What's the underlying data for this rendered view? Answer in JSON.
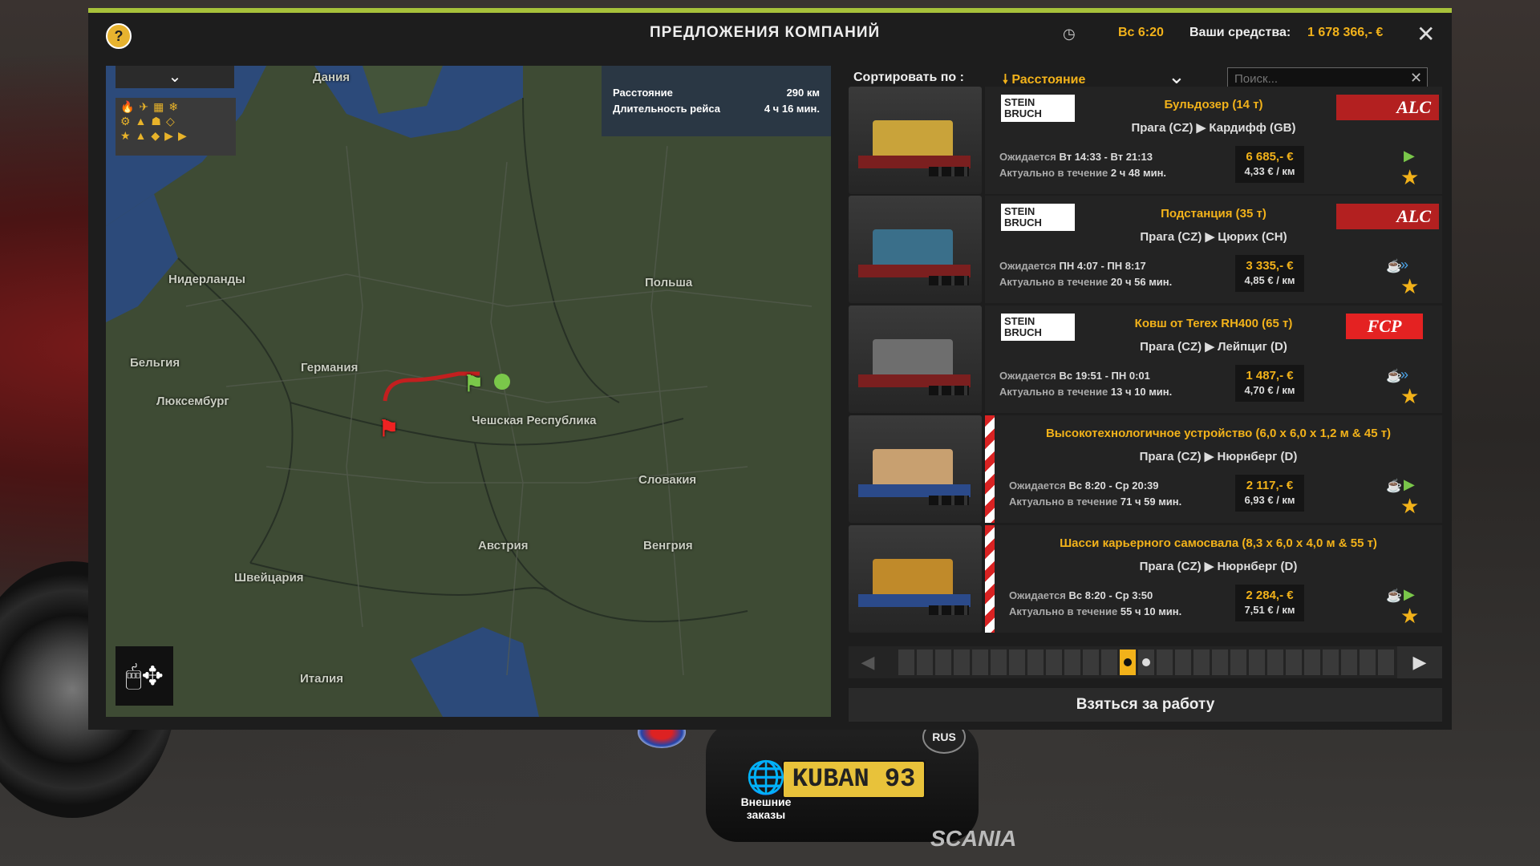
{
  "header": {
    "title": "ПРЕДЛОЖЕНИЯ КОМПАНИЙ",
    "help": "?",
    "clock_icon": "clock-icon",
    "time": "Вс 6:20",
    "funds_label": "Ваши средства:",
    "funds_value": "1 678 366,- €",
    "close": "✕"
  },
  "map": {
    "info": {
      "distance_label": "Расстояние",
      "distance_value": "290 км",
      "duration_label": "Длительность рейса",
      "duration_value": "4 ч 16 мин."
    },
    "labels": [
      "Дания",
      "Нидерланды",
      "Польша",
      "Бельгия",
      "Германия",
      "Люксембург",
      "Чешская Республика",
      "Словакия",
      "Австрия",
      "Венгрия",
      "Швейцария",
      "Италия"
    ],
    "filter_chevron": "⌄",
    "filter_icons": "🔥✈▦❄ ⚙▲☗◇ ★▲◆▶▶",
    "mouse_icon": "🖱✥"
  },
  "sort": {
    "label": "Сортировать по :",
    "value": "Расстояние",
    "chevron": "⌄",
    "search_placeholder": "Поиск...",
    "search_clear": "✕"
  },
  "jobs": [
    {
      "sender": "STEIN BRUCH",
      "receiver": "ALC",
      "cargo": "Бульдозер (14 т)",
      "route": "Прага (CZ) ▶ Кардифф (GB)",
      "expected_label": "Ожидается",
      "expected": "Вт 14:33 - Вт 21:13",
      "valid_label": "Актуально в течение",
      "valid": "2 ч 48 мин.",
      "price": "6 685,- €",
      "rate": "4,33 € / км",
      "hazard": false,
      "cup": false,
      "speed": "▶"
    },
    {
      "sender": "STEIN BRUCH",
      "receiver": "ALC",
      "cargo": "Подстанция (35 т)",
      "route": "Прага (CZ) ▶ Цюрих (CH)",
      "expected_label": "Ожидается",
      "expected": "ПН 4:07 - ПН 8:17",
      "valid_label": "Актуально в течение",
      "valid": "20 ч 56 мин.",
      "price": "3 335,- €",
      "rate": "4,85 € / км",
      "hazard": false,
      "cup": true,
      "speed": "»"
    },
    {
      "sender": "STEIN BRUCH",
      "receiver": "FCP",
      "cargo": "Ковш от Terex RH400 (65 т)",
      "route": "Прага (CZ) ▶ Лейпциг (D)",
      "expected_label": "Ожидается",
      "expected": "Вс 19:51 - ПН 0:01",
      "valid_label": "Актуально в течение",
      "valid": "13 ч 10 мин.",
      "price": "1 487,- €",
      "rate": "4,70 € / км",
      "hazard": false,
      "cup": true,
      "speed": "»"
    },
    {
      "sender": "",
      "receiver": "",
      "cargo": "Высокотехнологичное устройство (6,0 x 6,0 x 1,2 м & 45 т)",
      "route": "Прага (CZ) ▶ Нюрнберг (D)",
      "expected_label": "Ожидается",
      "expected": "Вс 8:20 - Ср 20:39",
      "valid_label": "Актуально в течение",
      "valid": "71 ч 59 мин.",
      "price": "2 117,- €",
      "rate": "6,93 € / км",
      "hazard": true,
      "cup": true,
      "speed": "▶"
    },
    {
      "sender": "",
      "receiver": "",
      "cargo": "Шасси карьерного самосвала (8,3 x 6,0 x 4,0 м & 55 т)",
      "route": "Прага (CZ) ▶ Нюрнберг (D)",
      "expected_label": "Ожидается",
      "expected": "Вс 8:20 - Ср 3:50",
      "valid_label": "Актуально в течение",
      "valid": "55 ч 10 мин.",
      "price": "2 284,- €",
      "rate": "7,51 € / км",
      "hazard": true,
      "cup": true,
      "speed": "▶"
    }
  ],
  "pager": {
    "prev": "◀",
    "next": "▶",
    "pages": 27,
    "current": 12
  },
  "take_job": "Взяться за работу",
  "external_orders": {
    "icon": "🌐",
    "label": "Внешние заказы"
  },
  "plate": "KUBAN 93",
  "rus_badge": "RUS",
  "brand": "SCANIA",
  "colors": {
    "accent": "#f2b21a",
    "top_bar": "#a7c13a",
    "route": "#c21f1f"
  }
}
